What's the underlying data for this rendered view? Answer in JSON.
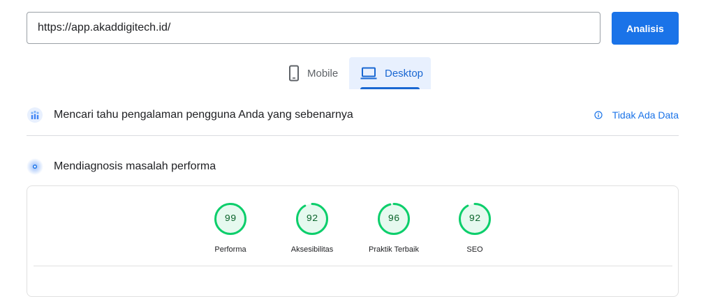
{
  "search": {
    "url_value": "https://app.akaddigitech.id/",
    "button_label": "Analisis"
  },
  "tabs": [
    {
      "label": "Mobile",
      "icon": "smartphone-icon",
      "active": false
    },
    {
      "label": "Desktop",
      "icon": "laptop-icon",
      "active": true
    }
  ],
  "field_section": {
    "title": "Mencari tahu pengalaman pengguna Anda yang sebenarnya",
    "status_label": "Tidak Ada Data",
    "icon": "field-data-icon"
  },
  "lab_section": {
    "title": "Mendiagnosis masalah performa",
    "icon": "lab-data-icon"
  },
  "scores": [
    {
      "label": "Performa",
      "value": "99"
    },
    {
      "label": "Aksesibilitas",
      "value": "92"
    },
    {
      "label": "Praktik Terbaik",
      "value": "96"
    },
    {
      "label": "SEO",
      "value": "92"
    }
  ],
  "colors": {
    "accent": "#1a73e8",
    "pass": "#0cce6b",
    "pass_text": "#0d652d",
    "tab_active_bg": "#e8f0fe"
  }
}
